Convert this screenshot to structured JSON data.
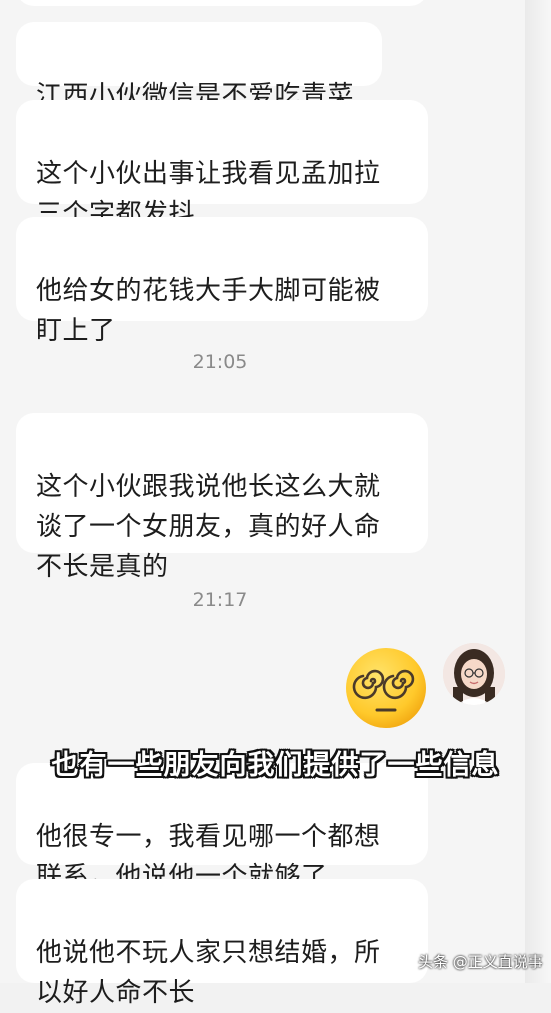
{
  "messages": [
    {
      "text": ""
    },
    {
      "text": "江西小伙微信是不爱吃青菜"
    },
    {
      "text": "这个小伙出事让我看见孟加拉\n三个字都发抖"
    },
    {
      "text": "他给女的花钱大手大脚可能被\n盯上了"
    },
    {
      "text": "这个小伙跟我说他长这么大就\n谈了一个女朋友，真的好人命\n不长是真的"
    },
    {
      "text": "他很专一，我看见哪一个都想\n联系，他说他一个就够了"
    },
    {
      "text": "他说他不玩人家只想结婚，所\n以好人命不长"
    }
  ],
  "timestamps": [
    "21:05",
    "21:17"
  ],
  "sent_sticker": {
    "icon": "dizzy-face-emoji"
  },
  "avatar": {
    "icon": "user-avatar-photo"
  },
  "subtitle": "也有一些朋友向我们提供了一些信息",
  "watermark": "头条 @正义直说事"
}
